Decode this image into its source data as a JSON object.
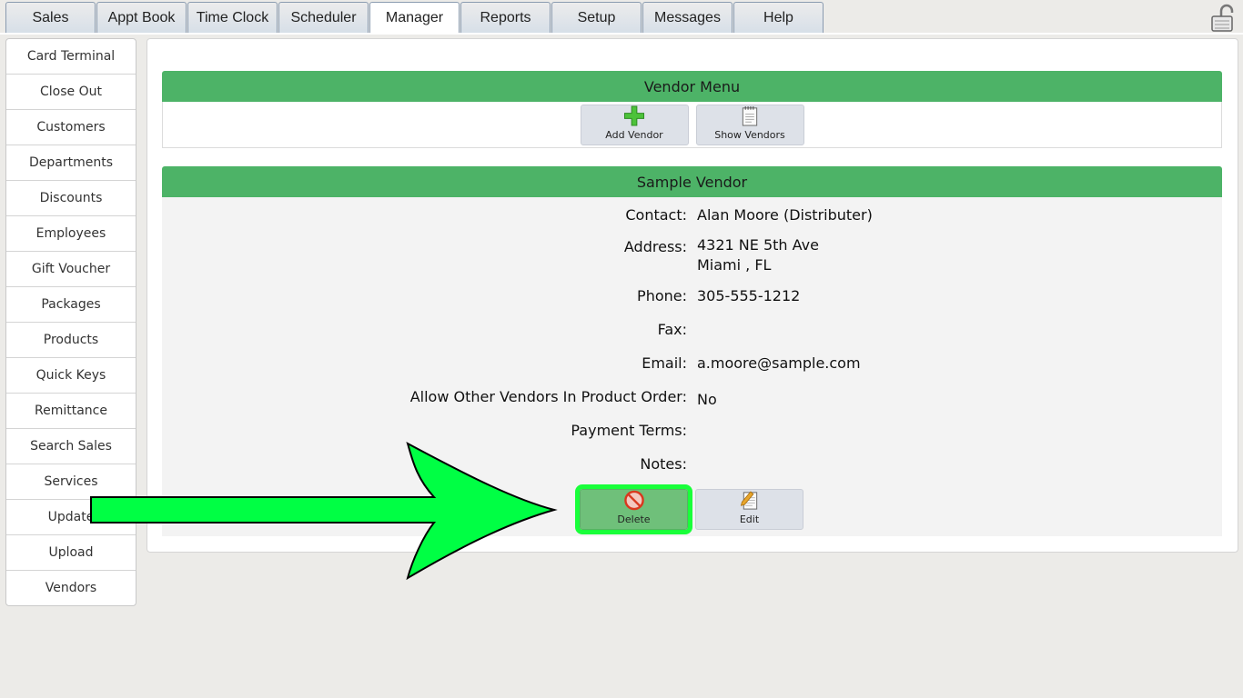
{
  "tabs": {
    "items": [
      "Sales",
      "Appt Book",
      "Time Clock",
      "Scheduler",
      "Manager",
      "Reports",
      "Setup",
      "Messages",
      "Help"
    ],
    "active": "Manager"
  },
  "header_icon": "padlock-icon",
  "sidebar": {
    "items": [
      "Card Terminal",
      "Close Out",
      "Customers",
      "Departments",
      "Discounts",
      "Employees",
      "Gift Voucher",
      "Packages",
      "Products",
      "Quick Keys",
      "Remittance",
      "Search Sales",
      "Services",
      "Update",
      "Upload",
      "Vendors"
    ]
  },
  "vendor_menu": {
    "title": "Vendor Menu",
    "add_label": "Add Vendor",
    "add_icon": "green-plus-icon",
    "show_label": "Show Vendors",
    "show_icon": "notepad-icon"
  },
  "vendor": {
    "title": "Sample Vendor",
    "fields": {
      "contact": {
        "label": "Contact:",
        "value": "Alan Moore (Distributer)"
      },
      "address": {
        "label": "Address:",
        "line1": "4321 NE 5th Ave",
        "line2": "Miami , FL"
      },
      "phone": {
        "label": "Phone:",
        "value": "305-555-1212"
      },
      "fax": {
        "label": "Fax:",
        "value": ""
      },
      "email": {
        "label": "Email:",
        "value": "a.moore@sample.com"
      },
      "allow_other": {
        "label": "Allow Other Vendors In Product Order:",
        "value": "No"
      },
      "payment_terms": {
        "label": "Payment Terms:",
        "value": ""
      },
      "notes": {
        "label": "Notes:",
        "value": ""
      }
    },
    "delete_label": "Delete",
    "delete_icon": "no-entry-icon",
    "edit_label": "Edit",
    "edit_icon": "edit-pencil-icon"
  },
  "colors": {
    "header_green": "#4db367",
    "highlight_green": "#19ff3a",
    "arrow_green": "#00ff44"
  }
}
